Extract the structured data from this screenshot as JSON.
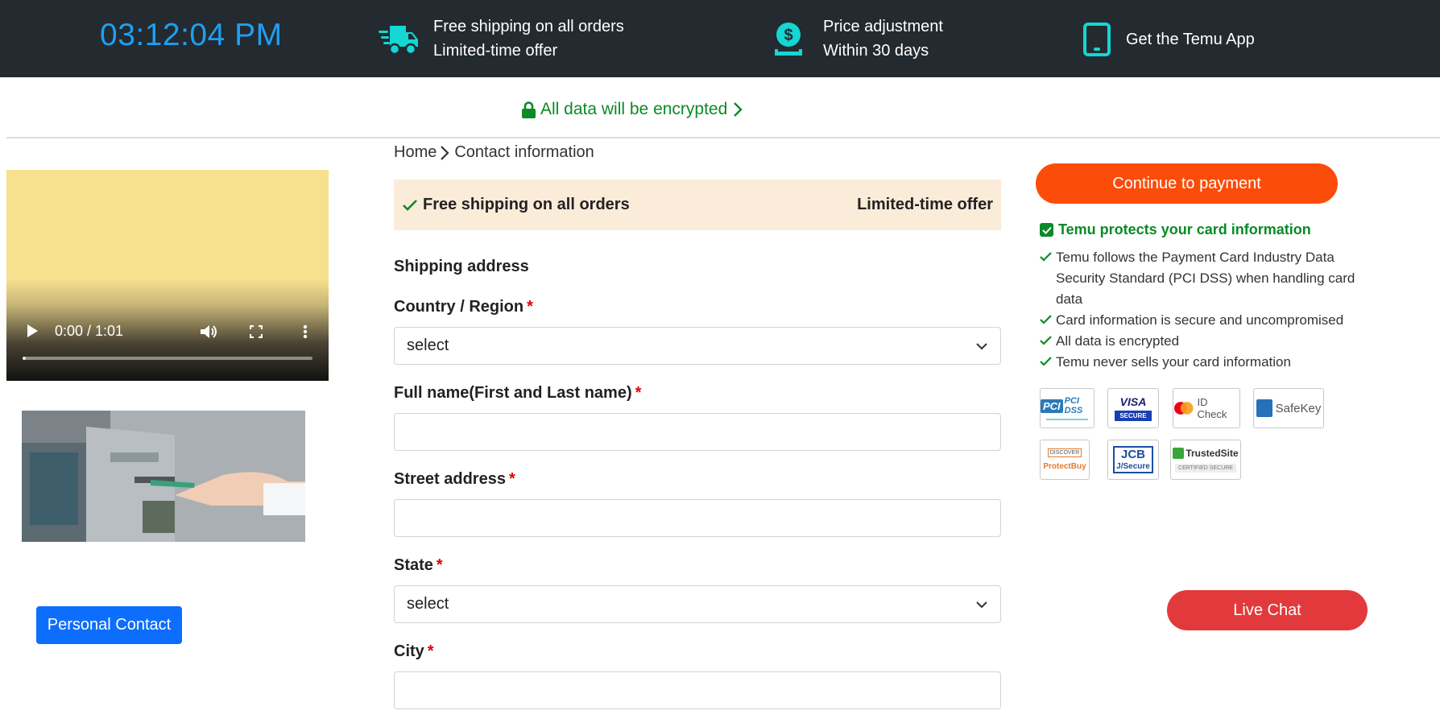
{
  "topbar": {
    "clock": "03:12:04 PM",
    "shipping": {
      "line1": "Free shipping on all orders",
      "line2": "Limited-time offer",
      "icon": "truck-icon"
    },
    "price": {
      "line1": "Price adjustment",
      "line2": "Within 30 days",
      "icon": "money-bag-icon"
    },
    "app": {
      "label": "Get the Temu App",
      "icon": "tablet-icon"
    },
    "icon_color": "#14d6d2"
  },
  "encrypt_notice": "All data will be encrypted",
  "video": {
    "time": "0:00 / 1:01",
    "progress": 0.0
  },
  "left": {
    "personal_contact_label": "Personal Contact"
  },
  "breadcrumb": {
    "home": "Home",
    "current": "Contact information"
  },
  "banner": {
    "left": "Free shipping on all orders",
    "right": "Limited-time offer"
  },
  "form": {
    "section_title": "Shipping address",
    "fields": [
      {
        "label": "Country / Region",
        "required": "*",
        "type": "select",
        "value": "select"
      },
      {
        "label": "Full name(First and Last name)",
        "required": "*",
        "type": "text",
        "value": ""
      },
      {
        "label": "Street address",
        "required": "*",
        "type": "text",
        "value": ""
      },
      {
        "label": "State",
        "required": "*",
        "type": "select",
        "value": "select"
      },
      {
        "label": "City",
        "required": "*",
        "type": "text",
        "value": ""
      }
    ]
  },
  "right": {
    "continue_label": "Continue to payment",
    "protect_title": "Temu protects your card information",
    "protect_points": [
      "Temu follows the Payment Card Industry Data Security Standard (PCI DSS) when handling card data",
      "Card information is secure and uncompromised",
      "All data is encrypted",
      "Temu never sells your card information"
    ],
    "badges": {
      "pci": "PCI DSS",
      "visa_top": "VISA",
      "visa_bottom": "SECURE",
      "mc": "ID Check",
      "amex": "SafeKey",
      "discover_top": "DISCOVER",
      "discover_bottom": "ProtectBuy",
      "jcb_top": "JCB",
      "jcb_bottom": "J/Secure",
      "trust_top": "TrustedSite",
      "trust_bottom": "CERTIFIED SECURE"
    },
    "live_chat_label": "Live Chat"
  },
  "colors": {
    "topbar_bg": "#232a30",
    "clock": "#1e9ff2",
    "accent_orange": "#fb4c0a",
    "green": "#0a8a27",
    "chat_red": "#e23a3c",
    "primary_blue": "#0d6efd",
    "banner_bg": "#fbebd9"
  }
}
